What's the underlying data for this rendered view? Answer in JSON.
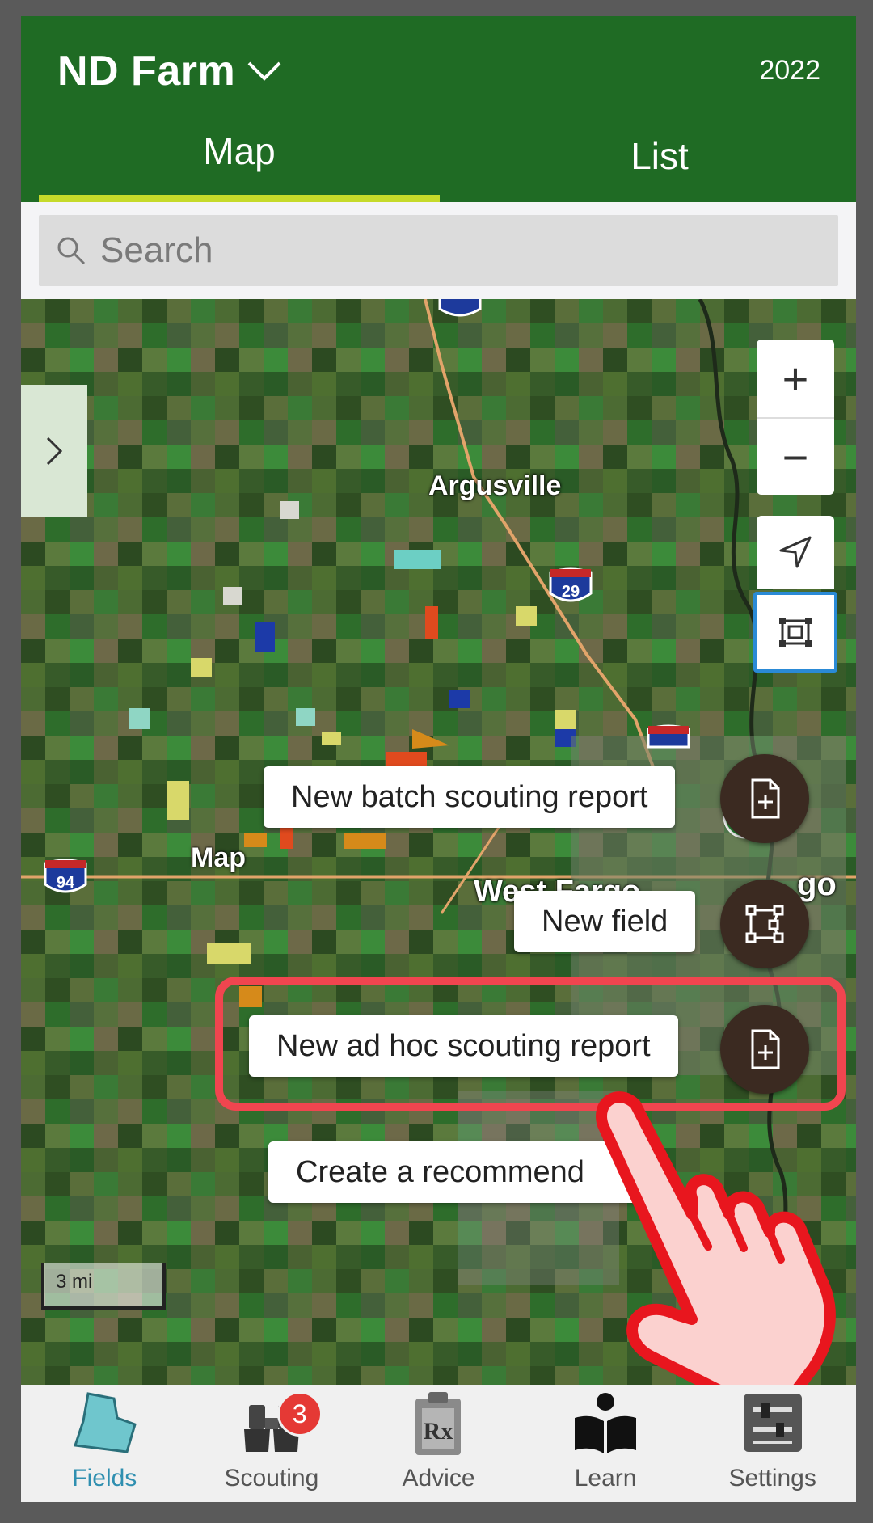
{
  "header": {
    "farm_name": "ND Farm",
    "year": "2022",
    "tabs": [
      {
        "label": "Map",
        "active": true
      },
      {
        "label": "List",
        "active": false
      }
    ]
  },
  "search": {
    "placeholder": "Search"
  },
  "map": {
    "place_labels": [
      "Argusville",
      "Map",
      "West Fargo",
      "go"
    ],
    "highways": [
      "29",
      "29",
      "94"
    ],
    "scale_label": "3 mi",
    "controls": {
      "zoom_in": "+",
      "zoom_out": "−"
    }
  },
  "action_menu": {
    "items": [
      {
        "label": "New batch scouting report",
        "icon": "document-add-icon"
      },
      {
        "label": "New field",
        "icon": "polygon-draw-icon"
      },
      {
        "label": "New ad hoc scouting report",
        "icon": "document-add-icon",
        "highlighted": true
      },
      {
        "label": "Create a recommend",
        "icon": ""
      }
    ]
  },
  "bottom_nav": {
    "items": [
      {
        "label": "Fields",
        "icon": "fields-icon",
        "active": true
      },
      {
        "label": "Scouting",
        "icon": "binoculars-icon",
        "badge": "3"
      },
      {
        "label": "Advice",
        "icon": "prescription-clipboard-icon"
      },
      {
        "label": "Learn",
        "icon": "reader-book-icon"
      },
      {
        "label": "Settings",
        "icon": "sliders-icon"
      }
    ]
  },
  "colors": {
    "header_green": "#1f6b24",
    "tab_underline": "#c6da2a",
    "fab_brown": "#3b2a21",
    "highlight_red": "#f0454f",
    "active_nav": "#2f8fb0",
    "badge_red": "#e53935"
  }
}
